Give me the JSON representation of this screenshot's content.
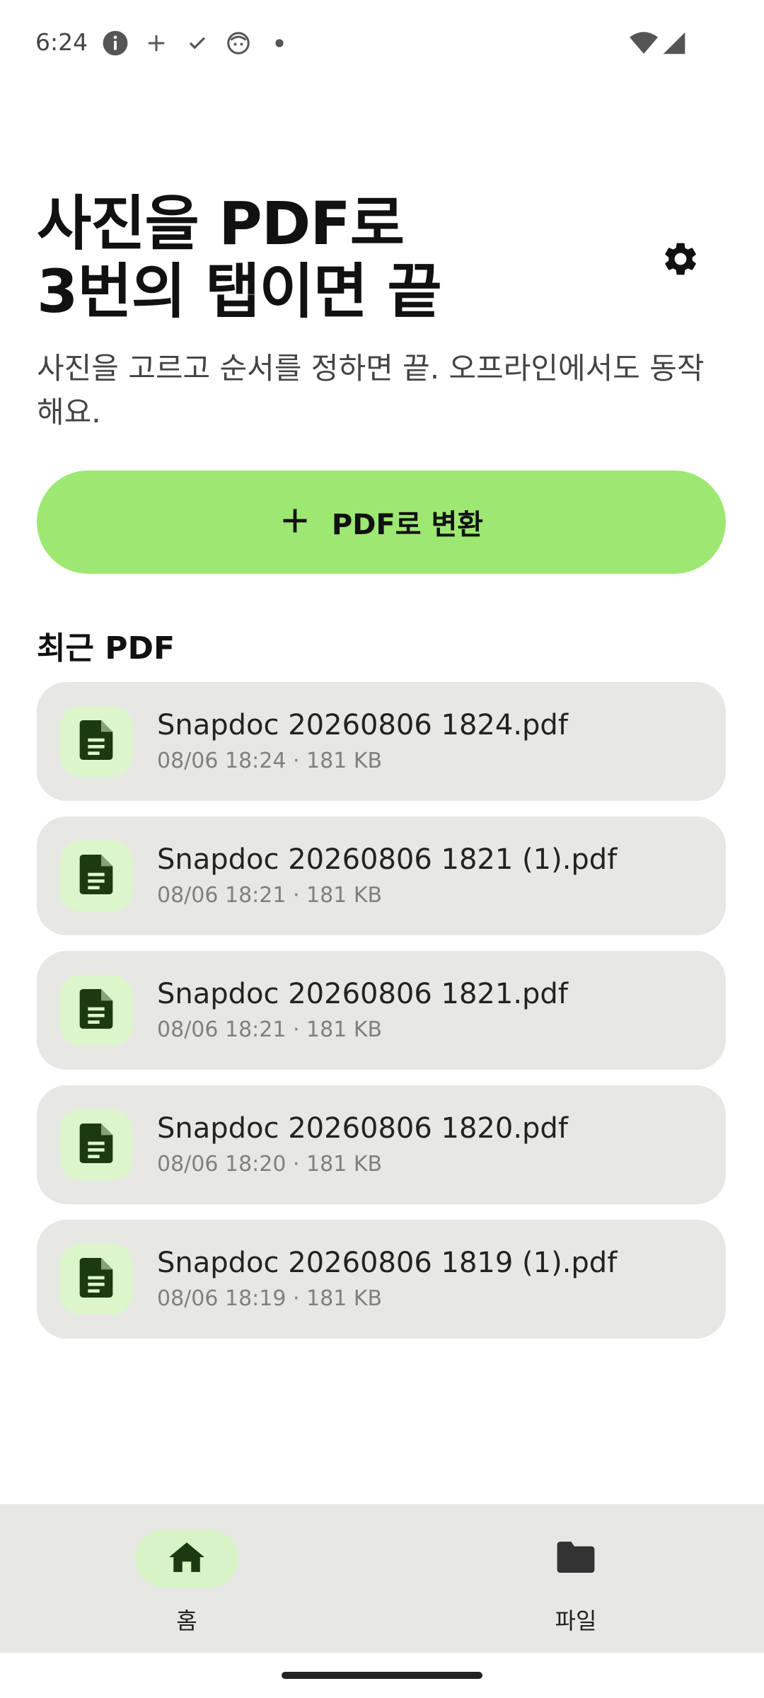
{
  "status_bar": {
    "time": "6:24",
    "icons": [
      "info-icon",
      "plus-icon",
      "check-icon",
      "face-icon",
      "dot-icon"
    ],
    "right_icons": [
      "wifi-icon",
      "signal-icon"
    ]
  },
  "header": {
    "title_line1": "사진을 PDF로",
    "title_line2": "3번의 탭이면 끝",
    "subtitle": "사진을 고르고 순서를 정하면 끝. 오프라인에서도 동작해요.",
    "settings_icon": "gear-icon"
  },
  "convert_button": {
    "label": "PDF로 변환",
    "icon": "plus-icon",
    "color": "#9de872"
  },
  "recent": {
    "title": "최근 PDF",
    "items": [
      {
        "name": "Snapdoc 20260806 1824.pdf",
        "meta": "08/06 18:24 · 181 KB"
      },
      {
        "name": "Snapdoc 20260806 1821 (1).pdf",
        "meta": "08/06 18:21 · 181 KB"
      },
      {
        "name": "Snapdoc 20260806 1821.pdf",
        "meta": "08/06 18:21 · 181 KB"
      },
      {
        "name": "Snapdoc 20260806 1820.pdf",
        "meta": "08/06 18:20 · 181 KB"
      },
      {
        "name": "Snapdoc 20260806 1819 (1).pdf",
        "meta": "08/06 18:19 · 181 KB"
      }
    ]
  },
  "bottom_nav": {
    "items": [
      {
        "label": "홈",
        "icon": "home-icon",
        "active": true
      },
      {
        "label": "파일",
        "icon": "folder-icon",
        "active": false
      }
    ]
  },
  "colors": {
    "accent": "#9de872",
    "card_bg": "#e7e8e3",
    "icon_tile": "#dcf5cb",
    "icon_fg": "#1b3a12"
  }
}
